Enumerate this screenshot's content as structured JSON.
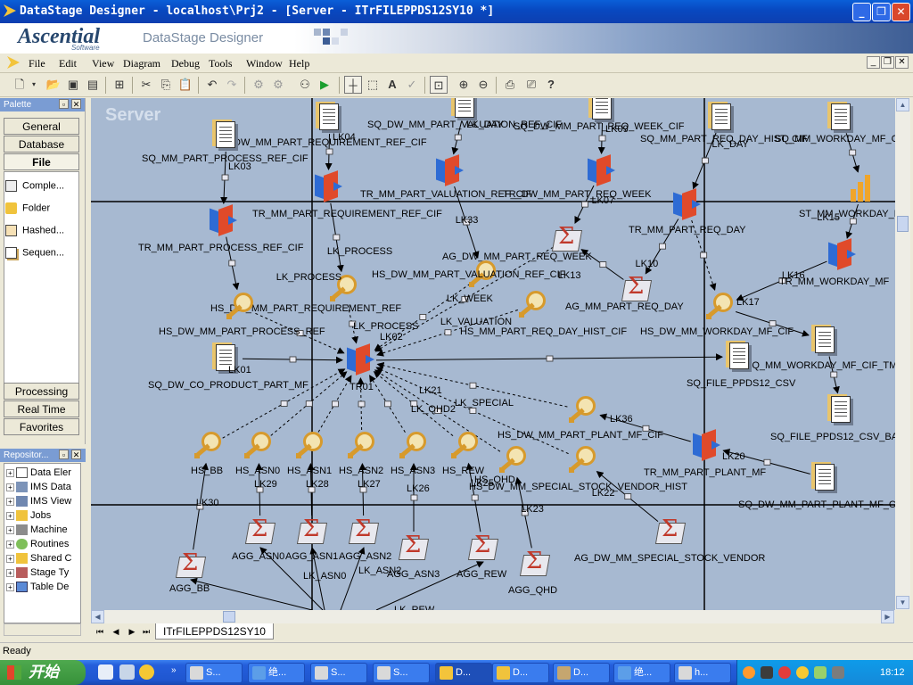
{
  "window": {
    "title": "DataStage Designer - localhost\\Prj2 - [Server - ITrFILEPPDS12SY10 *]"
  },
  "banner": {
    "logo": "Ascential",
    "logo_sub": "Software",
    "product": "DataStage Designer"
  },
  "menu": [
    "File",
    "Edit",
    "View",
    "Diagram",
    "Debug",
    "Tools",
    "Window",
    "Help"
  ],
  "palette": {
    "title": "Palette",
    "top_tabs": [
      "General",
      "Database",
      "File"
    ],
    "items": [
      "Comple...",
      "Folder",
      "Hashed...",
      "Sequen..."
    ],
    "bottom_tabs": [
      "Processing",
      "Real Time",
      "Favorites"
    ]
  },
  "repository": {
    "title": "Repositor...",
    "items": [
      "Data Eler",
      "IMS Data",
      "IMS View",
      "Jobs",
      "Machine",
      "Routines",
      "Shared C",
      "Stage Ty",
      "Table De"
    ]
  },
  "canvas": {
    "watermark": "Server",
    "nodes": [
      {
        "id": "n1",
        "kind": "seqfile",
        "label": "SQ_DW_MM_PART_REQUIREMENT_REF_CIF"
      },
      {
        "id": "n2",
        "kind": "seqfile",
        "label": "SQ_MM_PART_PROCESS_REF_CIF"
      },
      {
        "id": "n3",
        "kind": "seqfile",
        "label": "SQ_DW_MM_PART_VALUATION_REF_CIF"
      },
      {
        "id": "n4",
        "kind": "seqfile",
        "label": "SQ_DW_MM_PART_REQ_WEEK_CIF"
      },
      {
        "id": "n5",
        "kind": "seqfile",
        "label": "SQ_MM_PART_REQ_DAY_HIST_CIF"
      },
      {
        "id": "n6",
        "kind": "seqfile",
        "label": "SQ_MM_WORKDAY_MF_C"
      },
      {
        "id": "n7",
        "kind": "transformer",
        "label": "TR_MM_PART_REQUIREMENT_REF_CIF"
      },
      {
        "id": "n8",
        "kind": "transformer",
        "label": "TR_MM_PART_VALUATION_REF_CIF"
      },
      {
        "id": "n9",
        "kind": "transformer",
        "label": "TR_DW_MM_PART_REQ_WEEK"
      },
      {
        "id": "n10",
        "kind": "transformer",
        "label": "TR_MM_PART_REQ_DAY"
      },
      {
        "id": "n11",
        "kind": "transformer",
        "label": "TR_MM_PART_PROCESS_REF_CIF"
      },
      {
        "id": "n12",
        "kind": "agg",
        "label": "AG_DW_MM_PART_REQ_WEEK"
      },
      {
        "id": "n13",
        "kind": "agg",
        "label": "AG_MM_PART_REQ_DAY"
      },
      {
        "id": "n14",
        "kind": "hashed",
        "label": "HS_DW_MM_PART_REQUIREMENT_REF"
      },
      {
        "id": "n15",
        "kind": "hashed",
        "label": "HS_DW_MM_PART_VALUATION_REF_CIF"
      },
      {
        "id": "n16",
        "kind": "hashed",
        "label": "HS_DW_MM_PART_PROCESS_REF"
      },
      {
        "id": "n17",
        "kind": "hashed",
        "label": "HS_MM_PART_REQ_DAY_HIST_CIF"
      },
      {
        "id": "n18",
        "kind": "hashed",
        "label": "HS_DW_MM_WORKDAY_MF_CIF"
      },
      {
        "id": "n19",
        "kind": "bars",
        "label": "ST_MM_WORKDAY_MF"
      },
      {
        "id": "n20",
        "kind": "transformer",
        "label": "TR_MM_WORKDAY_MF"
      },
      {
        "id": "n21",
        "kind": "seqfile",
        "label": "SQ_MM_WORKDAY_MF_CIF_TM"
      },
      {
        "id": "n22",
        "kind": "seqfile",
        "label": "SQ_DW_CO_PRODUCT_PART_MF"
      },
      {
        "id": "n23",
        "kind": "transformer",
        "label": "TR01"
      },
      {
        "id": "n24",
        "kind": "seqfile",
        "label": "SQ_FILE_PPDS12_CSV"
      },
      {
        "id": "n25",
        "kind": "seqfile",
        "label": "SQ_FILE_PPDS12_CSV_BA"
      },
      {
        "id": "n26",
        "kind": "hashed",
        "label": "HS_DW_MM_PART_PLANT_MF_CIF"
      },
      {
        "id": "n27",
        "kind": "transformer",
        "label": "TR_MM_PART_PLANT_MF"
      },
      {
        "id": "n28",
        "kind": "seqfile",
        "label": "SQ_DW_MM_PART_PLANT_MF_C"
      },
      {
        "id": "n29",
        "kind": "hashed",
        "label": "HS_DW_MM_SPECIAL_STOCK_VENDOR_HIST"
      },
      {
        "id": "n30",
        "kind": "hashed",
        "label": "HS_QHD"
      },
      {
        "id": "n31",
        "kind": "hashed",
        "label": "HS_BB"
      },
      {
        "id": "n32",
        "kind": "hashed",
        "label": "HS_ASN0"
      },
      {
        "id": "n33",
        "kind": "hashed",
        "label": "HS_ASN1"
      },
      {
        "id": "n34",
        "kind": "hashed",
        "label": "HS_ASN2"
      },
      {
        "id": "n35",
        "kind": "hashed",
        "label": "HS_ASN3"
      },
      {
        "id": "n36",
        "kind": "hashed",
        "label": "HS_REW"
      },
      {
        "id": "n37",
        "kind": "agg",
        "label": "AGG_BB"
      },
      {
        "id": "n38",
        "kind": "agg",
        "label": "AGG_ASN0"
      },
      {
        "id": "n39",
        "kind": "agg",
        "label": "AGG_ASN1"
      },
      {
        "id": "n40",
        "kind": "agg",
        "label": "AGG_ASN2"
      },
      {
        "id": "n41",
        "kind": "agg",
        "label": "AGG_ASN3"
      },
      {
        "id": "n42",
        "kind": "agg",
        "label": "AGG_REW"
      },
      {
        "id": "n43",
        "kind": "agg",
        "label": "AGG_QHD"
      },
      {
        "id": "n44",
        "kind": "agg",
        "label": "AG_DW_MM_SPECIAL_STOCK_VENDOR"
      }
    ],
    "links": [
      "LK03",
      "LK04",
      "LK05",
      "LK_DAY",
      "LK09",
      "LK33",
      "LK07",
      "LK10",
      "LK11",
      "LK13",
      "LK_PROCESS",
      "LK_VALUATION",
      "LK_WEEK",
      "LK02",
      "LK01",
      "LK_REW2",
      "LK21",
      "LK_ASN3",
      "LK_ASN2",
      "LK_ASN0",
      "LK_SPECIAL",
      "LK_QHD2",
      "LK36",
      "LK20",
      "LK17",
      "LK16",
      "LK15",
      "LK29",
      "LK28",
      "LK27",
      "LK26",
      "LK30",
      "LK25",
      "LK23",
      "LK22",
      "LK_ASN0",
      "LK_ASN2",
      "LK_REW",
      "LK18"
    ]
  },
  "tab": {
    "label": "ITrFILEPPDS12SY10"
  },
  "status": {
    "text": "Ready"
  },
  "taskbar": {
    "start": "开始",
    "tasks": [
      "S...",
      "绝...",
      "S...",
      "S...",
      "D...",
      "D...",
      "D...",
      "绝...",
      "h..."
    ],
    "clock": "18:12"
  }
}
